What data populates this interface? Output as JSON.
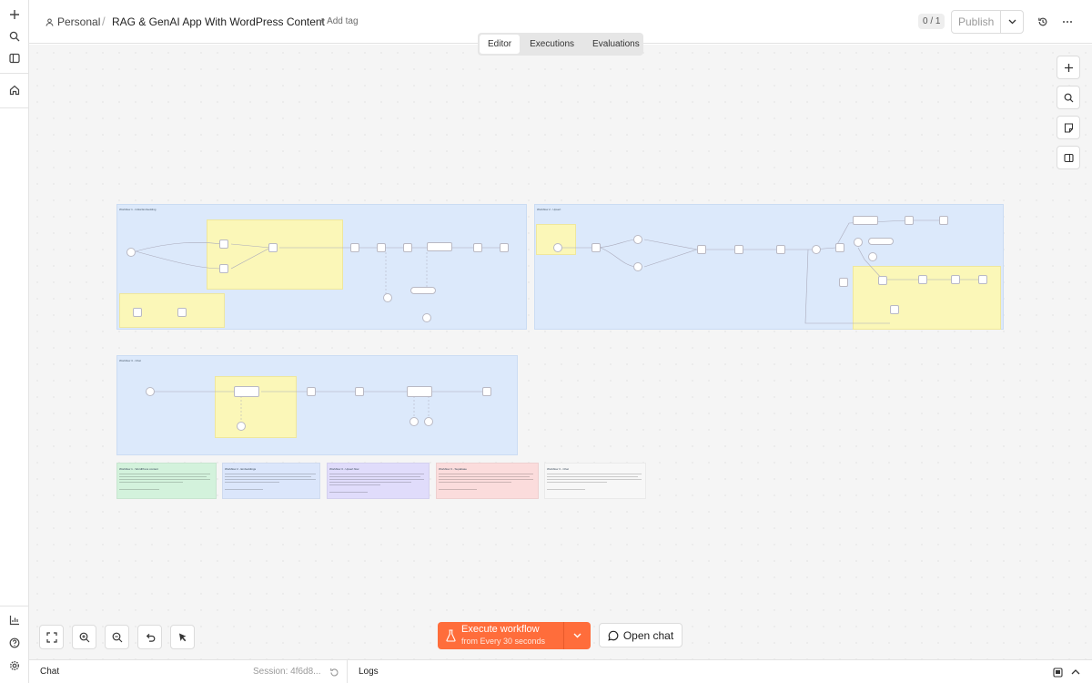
{
  "header": {
    "project": "Personal",
    "separator": "/",
    "workflow_title": "RAG & GenAI App With WordPress Content",
    "add_tag": "+ Add tag",
    "counter": "0 / 1",
    "publish_label": "Publish"
  },
  "tabs": [
    {
      "label": "Editor",
      "active": true
    },
    {
      "label": "Executions",
      "active": false
    },
    {
      "label": "Evaluations",
      "active": false
    }
  ],
  "canvas": {
    "groups": [
      {
        "title": "Workflow 1 - Initial Embedding"
      },
      {
        "title": "Workflow 2 - Upsert"
      },
      {
        "title": "Workflow 3 - Chat"
      }
    ],
    "notes": [
      {
        "title": "Workflow 1 - WordPress content"
      },
      {
        "title": "Workflow 2 - Embeddings"
      },
      {
        "title": "Workflow 3 - Upsert flow"
      },
      {
        "title": "Workflow 3 - Supabase"
      },
      {
        "title": "Workflow 3 - Chat"
      }
    ]
  },
  "toolbar": {
    "execute_label": "Execute workflow",
    "execute_sub": "from Every 30 seconds",
    "open_chat_label": "Open chat"
  },
  "bottom": {
    "chat_label": "Chat",
    "session": "Session: 4f6d8...",
    "logs_label": "Logs"
  },
  "colors": {
    "accent": "#ff6d3b",
    "group_bg": "#dce9fb",
    "sticky_yellow": "#fbf7b8"
  },
  "icons": [
    "plus-icon",
    "search-icon",
    "sidebar-toggle-icon",
    "home-icon",
    "insights-icon",
    "help-icon",
    "settings-icon",
    "history-icon",
    "more-icon",
    "fit-view-icon",
    "zoom-in-icon",
    "zoom-out-icon",
    "undo-icon",
    "cursor-icon",
    "flask-icon",
    "chevron-down-icon",
    "chat-bubble-icon",
    "pop-out-icon",
    "chevron-up-icon",
    "user-icon",
    "sticky-note-icon",
    "panel-icon",
    "refresh-icon"
  ]
}
